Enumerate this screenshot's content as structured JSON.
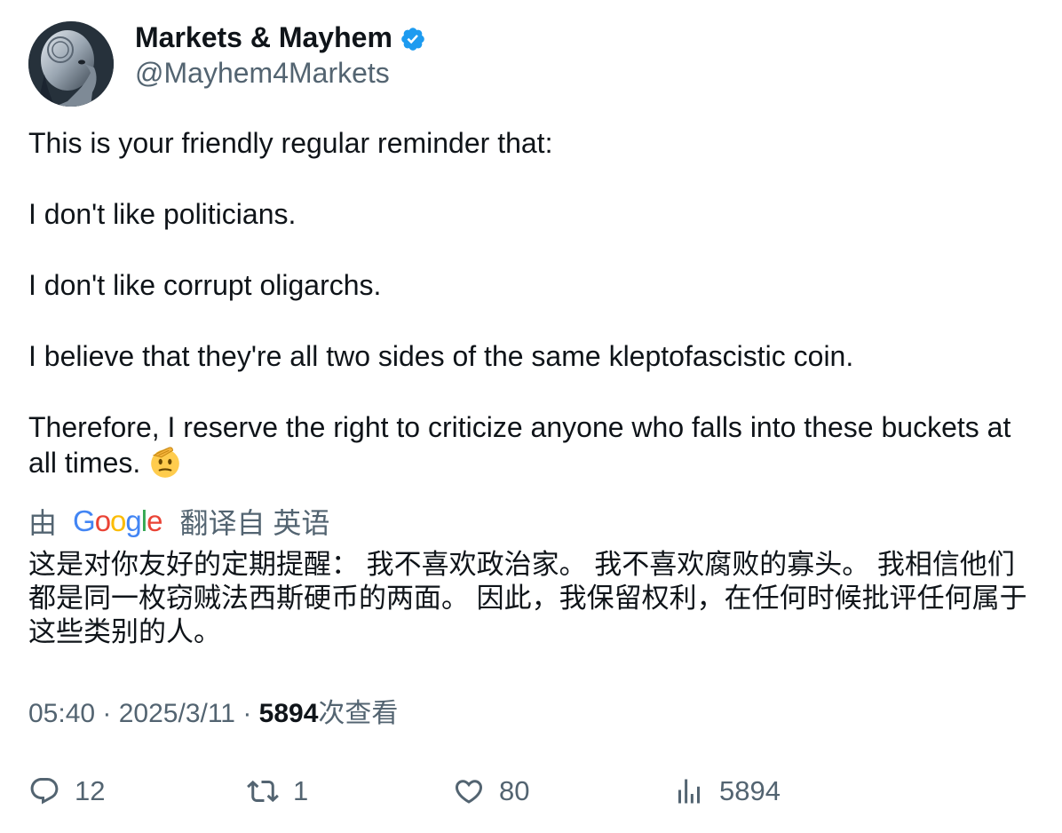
{
  "author": {
    "name": "Markets & Mayhem",
    "handle": "@Mayhem4Markets",
    "verified": true
  },
  "tweet": {
    "paragraphs": [
      "This is your friendly regular reminder that:",
      "I don't like politicians.",
      "I don't like corrupt oligarchs.",
      "I believe that they're all two sides of the same kleptofascistic coin.",
      "Therefore, I reserve the right to criticize anyone who falls into these buckets at all times."
    ],
    "emoji": "saluting-face"
  },
  "translation": {
    "by": "由",
    "provider": "Google",
    "label": "翻译自 英语",
    "text": "这是对你友好的定期提醒： 我不喜欢政治家。 我不喜欢腐败的寡头。 我相信他们都是同一枚窃贼法西斯硬币的两面。 因此，我保留权利，在任何时候批评任何属于这些类别的人。"
  },
  "meta": {
    "time": "05:40",
    "sep1": " · ",
    "date": "2025/3/11",
    "sep2": " · ",
    "views": "5894",
    "views_label": "次查看"
  },
  "actions": {
    "reply": "12",
    "retweet": "1",
    "like": "80",
    "views": "5894"
  },
  "colors": {
    "text": "#0f1419",
    "secondary": "#536471",
    "verified": "#1d9bf0"
  }
}
